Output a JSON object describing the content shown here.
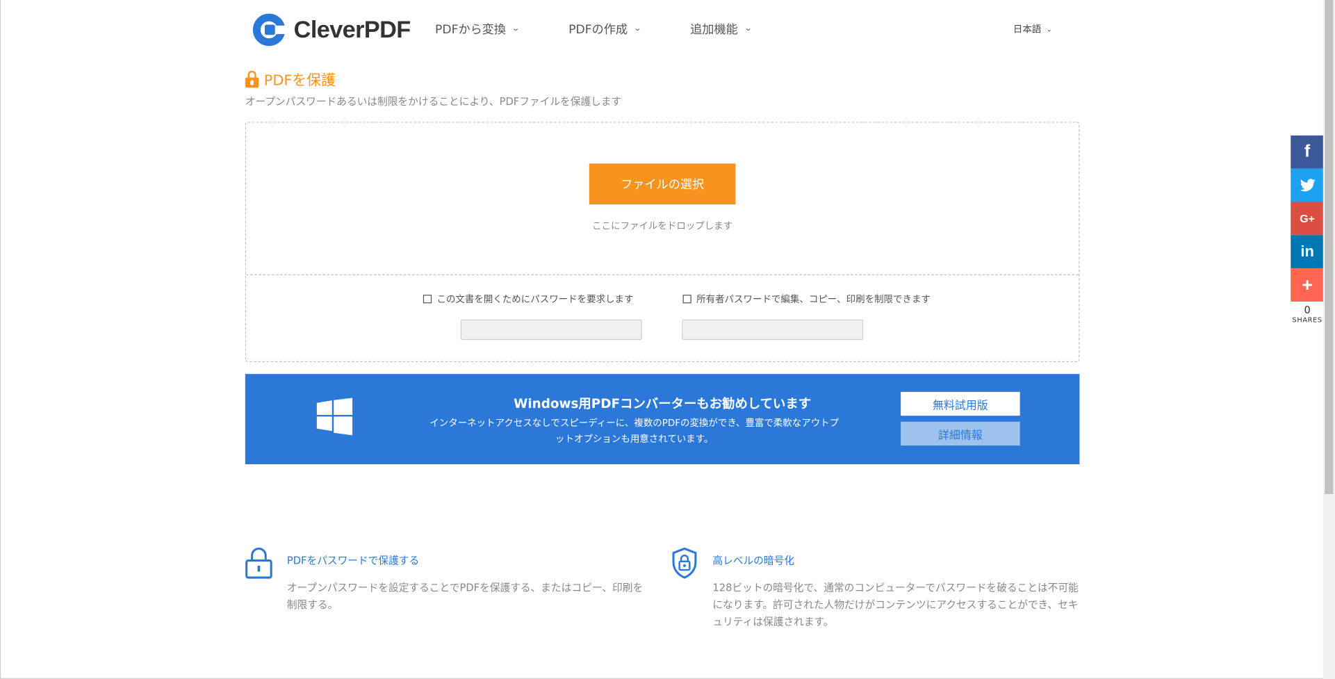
{
  "header": {
    "logo_text": "CleverPDF",
    "nav": [
      {
        "label": "PDFから変換"
      },
      {
        "label": "PDFの作成"
      },
      {
        "label": "追加機能"
      }
    ],
    "language": "日本語"
  },
  "page": {
    "title": "PDFを保護",
    "subtitle": "オープンパスワードあるいは制限をかけることにより、PDFファイルを保護します"
  },
  "upload": {
    "choose_label": "ファイルの選択",
    "drop_hint": "ここにファイルをドロップします",
    "option_open": "この文書を開くためにパスワードを要求します",
    "option_owner": "所有者パスワードで編集、コピー、印刷を制限できます",
    "open_password_value": "",
    "owner_password_value": ""
  },
  "banner": {
    "title": "Windows用PDFコンバーターもお勧めしています",
    "description": "インターネットアクセスなしでスピーディーに、複数のPDFの変換ができ、豊富で柔軟なアウトプットオプションも用意されています。",
    "trial_label": "無料試用版",
    "detail_label": "詳細情報"
  },
  "features": [
    {
      "icon": "lock-icon",
      "title": "PDFをパスワードで保護する",
      "text": "オープンパスワードを設定することでPDFを保護する、またはコピー、印刷を制限する。"
    },
    {
      "icon": "shield-lock-icon",
      "title": "高レベルの暗号化",
      "text": "128ビットの暗号化で、通常のコンピューターでパスワードを破ることは不可能になります。許可された人物だけがコンテンツにアクセスすることができ、セキュリティは保護されます。"
    }
  ],
  "social": {
    "buttons": [
      {
        "icon": "facebook-icon",
        "glyph": "f"
      },
      {
        "icon": "twitter-icon",
        "glyph": "🐦"
      },
      {
        "icon": "google-plus-icon",
        "glyph": "G+"
      },
      {
        "icon": "linkedin-icon",
        "glyph": "in"
      },
      {
        "icon": "plus-icon",
        "glyph": "+"
      }
    ],
    "count": "0",
    "count_label": "SHARES"
  },
  "colors": {
    "accent_orange": "#f7931e",
    "brand_blue": "#2b78d8"
  }
}
